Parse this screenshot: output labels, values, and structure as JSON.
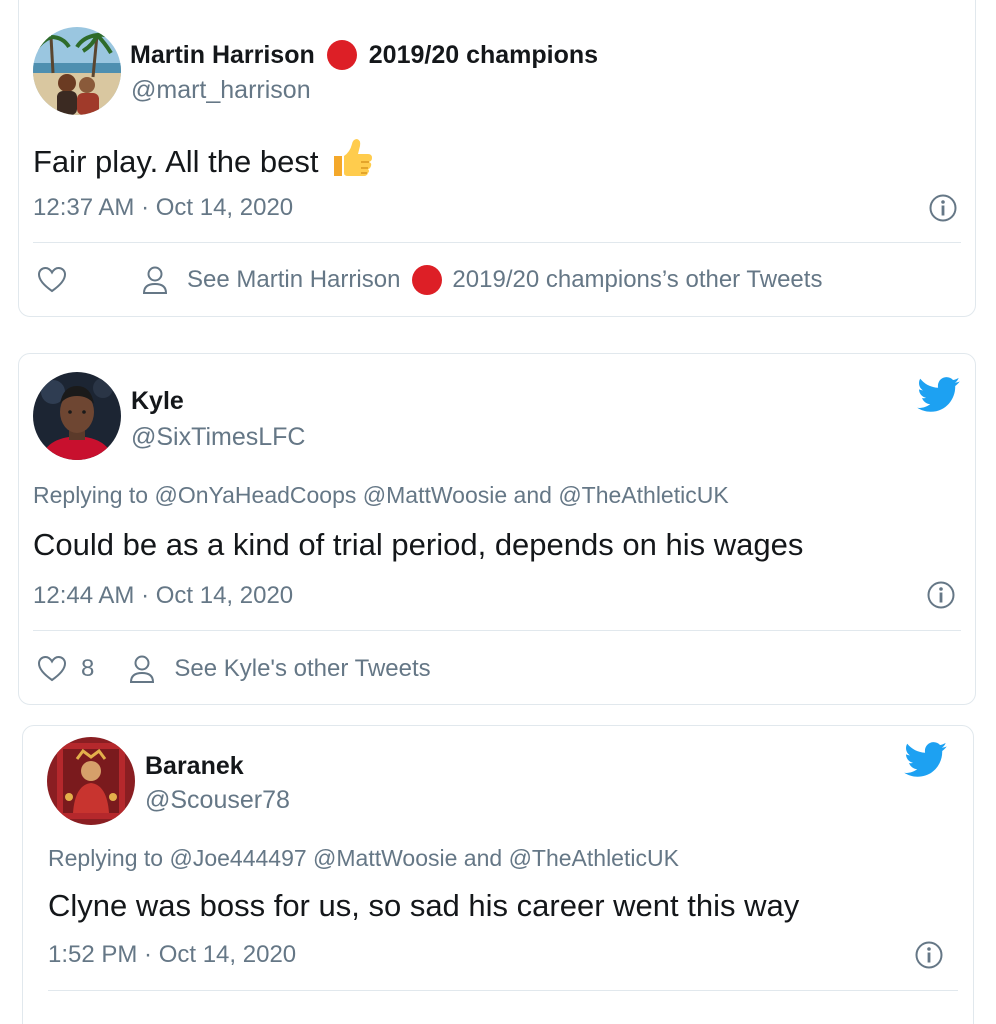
{
  "colors": {
    "twitter_blue": "#1da1f2",
    "red_dot": "#dd1f26",
    "muted_text": "#657786",
    "border": "#e1e8ed"
  },
  "tweets": [
    {
      "name": "Martin Harrison",
      "name_suffix": "2019/20 champions",
      "handle": "@mart_harrison",
      "replying_prefix": "",
      "replying_to": [],
      "replying_and": "",
      "text": "Fair play. All the best",
      "emoji": "👍",
      "time": "12:37 AM · Oct 14, 2020",
      "like_count": "",
      "other_tweets_prefix": "See Martin Harrison",
      "other_tweets_suffix": "2019/20 champions’s other Tweets",
      "icons": [
        "heart-icon",
        "person-icon",
        "info-icon"
      ]
    },
    {
      "name": "Kyle",
      "handle": "@SixTimesLFC",
      "replying_prefix": "Replying to",
      "replying_to": [
        "@OnYaHeadCoops",
        "@MattWoosie",
        "@TheAthleticUK"
      ],
      "replying_and": "and",
      "text": "Could be as a kind of trial period, depends on his wages",
      "time": "12:44 AM · Oct 14, 2020",
      "like_count": "8",
      "other_tweets": "See Kyle's other Tweets",
      "icons": [
        "twitter-bird-icon",
        "heart-icon",
        "person-icon",
        "info-icon"
      ]
    },
    {
      "name": "Baranek",
      "handle": "@Scouser78",
      "replying_prefix": "Replying to",
      "replying_to": [
        "@Joe444497",
        "@MattWoosie",
        "@TheAthleticUK"
      ],
      "replying_and": "and",
      "text": "Clyne was boss for us, so sad his career went this way",
      "time": "1:52 PM · Oct 14, 2020",
      "icons": [
        "twitter-bird-icon",
        "info-icon"
      ]
    }
  ]
}
